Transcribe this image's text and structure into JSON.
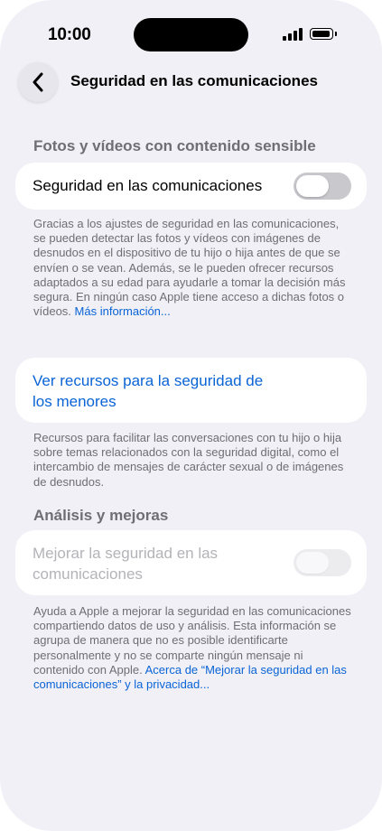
{
  "status_bar": {
    "time": "10:00"
  },
  "nav": {
    "title": "Seguridad en las comunicaciones"
  },
  "section_photos": {
    "header": "Fotos y vídeos con contenido sensible",
    "toggle_label": "Seguridad en las comunicaciones",
    "toggle_on": false,
    "footer_text": "Gracias a los ajustes de seguridad en las comunicaciones, se pueden detectar las fotos y vídeos con imágenes de desnudos en el dispositivo de tu hijo o hija antes de que se envíen o se vean. Además, se le pueden ofrecer recursos adaptados a su edad para ayudarle a tomar la decisión más segura. En ningún caso Apple tiene acceso a dichas fotos o vídeos.",
    "footer_link": "Más información..."
  },
  "section_resources": {
    "link_label": "Ver recursos para la seguridad de los menores",
    "footer_text": "Recursos para facilitar las conversaciones con tu hijo o hija sobre temas relacionados con la seguridad digital, como el intercambio de mensajes de carácter sexual o de imágenes de desnudos."
  },
  "section_analysis": {
    "header": "Análisis y mejoras",
    "toggle_label": "Mejorar la seguridad en las comunicaciones",
    "toggle_on": false,
    "toggle_enabled": false,
    "footer_text": "Ayuda a Apple a mejorar la seguridad en las comunicaciones compartiendo datos de uso y análisis. Esta información se agrupa de manera que no es posible identificarte personalmente y no se comparte ningún mensaje ni contenido con Apple.",
    "footer_link": "Acerca de “Mejorar la seguridad en las comunicaciones” y la privacidad..."
  },
  "icons": {
    "back": "chevron-left-icon",
    "signal": "cellular-signal-icon",
    "battery": "battery-icon"
  },
  "colors": {
    "background": "#f0f0f6",
    "link": "#0a64d6",
    "secondary_text": "#6e6e73",
    "toggle_off": "#c8c8cd"
  }
}
